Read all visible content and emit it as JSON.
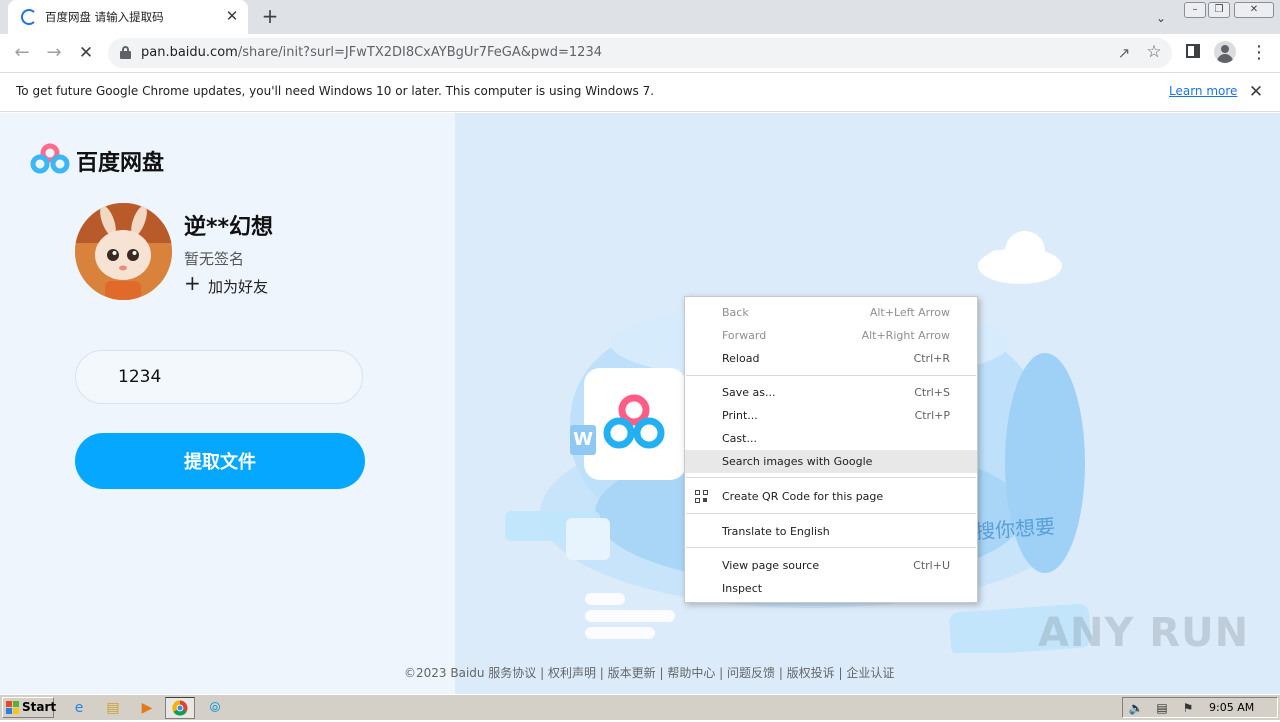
{
  "browser": {
    "tab_title": "百度网盘 请输入提取码",
    "tab_close": "✕",
    "new_tab": "+",
    "url_host": "pan.baidu.com",
    "url_path": "/share/init?surl=JFwTX2DI8CxAYBgUr7FeGA&pwd=1234",
    "icons": [
      "back-icon",
      "forward-icon",
      "stop-icon",
      "lock-icon",
      "share-icon",
      "star-icon",
      "side-panel-icon",
      "profile-icon",
      "menu-icon"
    ]
  },
  "infobar": {
    "message": "To get future Google Chrome updates, you'll need Windows 10 or later. This computer is using Windows 7.",
    "learn_more": "Learn more",
    "close": "✕"
  },
  "page": {
    "logo_text": "百度网盘",
    "username": "逆**幻想",
    "signature": "暂无签名",
    "add_friend": "加为好友",
    "code_value": "1234",
    "extract_button": "提取文件",
    "footer": "©2023 Baidu  服务协议 | 权利声明 | 版本更新 | 帮助中心 | 问题反馈 | 版权投诉 | 企业认证",
    "hero_search_text": "搜你想要",
    "hero_doc_letter": "W",
    "watermark": "ANY RUN",
    "accent_color": "#06a7ff"
  },
  "context_menu": {
    "items": [
      {
        "label": "Back",
        "shortcut": "Alt+Left Arrow",
        "disabled": true
      },
      {
        "label": "Forward",
        "shortcut": "Alt+Right Arrow",
        "disabled": true
      },
      {
        "label": "Reload",
        "shortcut": "Ctrl+R",
        "disabled": false
      },
      {
        "label": "Save as...",
        "shortcut": "Ctrl+S",
        "disabled": false
      },
      {
        "label": "Print...",
        "shortcut": "Ctrl+P",
        "disabled": false
      },
      {
        "label": "Cast...",
        "shortcut": "",
        "disabled": false
      },
      {
        "label": "Search images with Google",
        "shortcut": "",
        "disabled": false,
        "highlighted": true
      },
      {
        "label": "Create QR Code for this page",
        "shortcut": "",
        "disabled": false,
        "icon": "qr-code-icon"
      },
      {
        "label": "Translate to English",
        "shortcut": "",
        "disabled": false
      },
      {
        "label": "View page source",
        "shortcut": "Ctrl+U",
        "disabled": false
      },
      {
        "label": "Inspect",
        "shortcut": "",
        "disabled": false
      }
    ]
  },
  "taskbar": {
    "start": "Start",
    "clock": "9:05 AM",
    "pinned": [
      "ie-icon",
      "explorer-icon",
      "media-player-icon",
      "chrome-icon",
      "edge-icon"
    ]
  }
}
